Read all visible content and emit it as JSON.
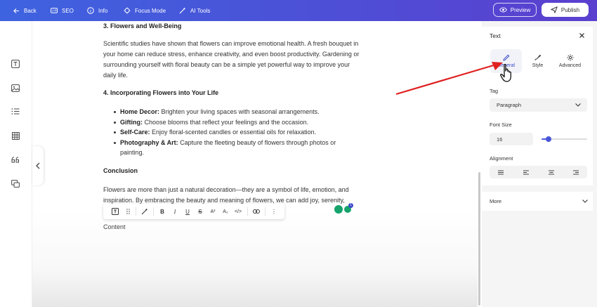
{
  "topbar": {
    "back": "Back",
    "seo": "SEO",
    "info": "Info",
    "focus": "Focus Mode",
    "ai_tools": "AI Tools",
    "preview": "Preview",
    "publish": "Publish",
    "gradient_start": "#3e63e0",
    "gradient_end": "#5b3fcf"
  },
  "sidebar": {
    "icons": [
      "text-block-icon",
      "image-icon",
      "list-icon",
      "table-icon",
      "quote-icon",
      "embed-icon"
    ]
  },
  "article": {
    "h3": "3. Flowers and Well-Being",
    "p1": "Scientific studies have shown that flowers can improve emotional health. A fresh bouquet in your home can reduce stress, enhance creativity, and even boost productivity. Gardening or surrounding yourself with floral beauty can be a simple yet powerful way to improve your daily life.",
    "h4": "4. Incorporating Flowers into Your Life",
    "bullets": [
      {
        "bold": "Home Decor:",
        "text": " Brighten your living spaces with seasonal arrangements."
      },
      {
        "bold": "Gifting:",
        "text": " Choose blooms that reflect your feelings and the occasion."
      },
      {
        "bold": "Self-Care:",
        "text": " Enjoy floral-scented candles or essential oils for relaxation."
      },
      {
        "bold": "Photography & Art:",
        "text": " Capture the fleeting beauty of flowers through photos or painting."
      }
    ],
    "conclusion": "Conclusion",
    "p2": "Flowers are more than just a natural decoration—they are a symbol of life, emotion, and inspiration. By embracing the beauty and meaning of flowers, we can add joy, serenity,",
    "placeholder": "Content"
  },
  "toolbar": {
    "bold": "B",
    "italic": "I",
    "underline": "U",
    "strike": "S",
    "superscript": "A²",
    "subscript": "A₂",
    "code": "</>",
    "more": "⋮"
  },
  "panel": {
    "title": "Text",
    "tabs": [
      {
        "label": "General",
        "icon": "pencil-icon",
        "active": true
      },
      {
        "label": "Style",
        "icon": "paint-brush-icon",
        "active": false
      },
      {
        "label": "Advanced",
        "icon": "gear-icon",
        "active": false
      }
    ],
    "tag_label": "Tag",
    "tag_value": "Paragraph",
    "font_size_label": "Font Size",
    "font_size_value": "16",
    "font_size_slider_fraction": 0.15,
    "alignment_label": "Alignment",
    "more_label": "More",
    "accent": "#4a56d8"
  },
  "badge_count": "1"
}
